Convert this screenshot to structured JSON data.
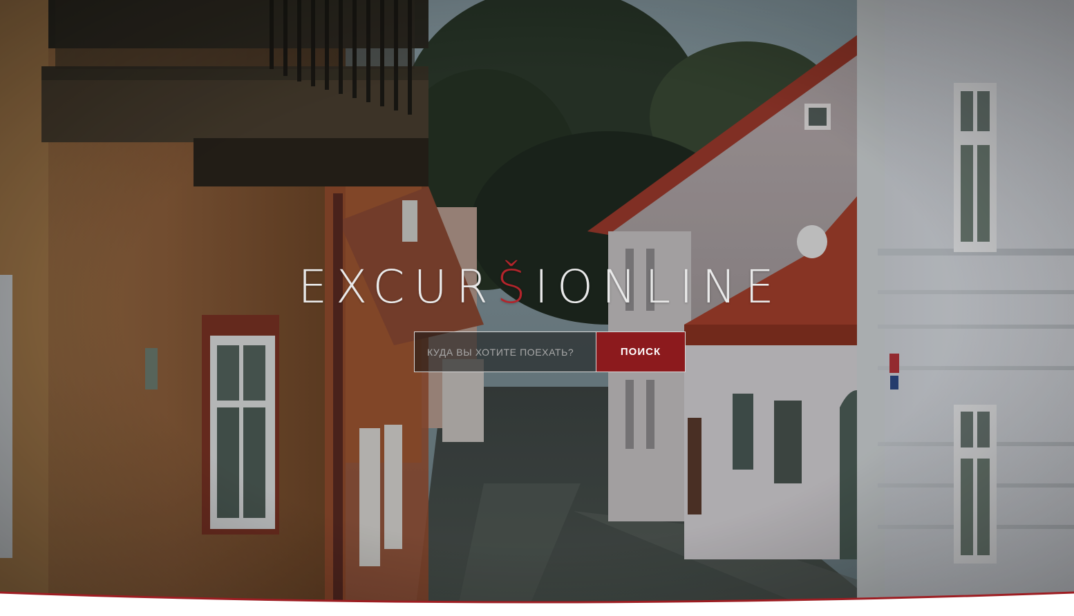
{
  "brand": {
    "logo_before": "EXCUR",
    "logo_accent": "Š",
    "logo_after": "IONLINE",
    "accent_color": "#b3242b"
  },
  "search": {
    "placeholder": "КУДА ВЫ ХОТИТЕ ПОЕХАТЬ?",
    "value": "",
    "button_label": "ПОИСК",
    "button_color": "#8c1a1d"
  },
  "hero": {
    "background_icon": "street-photo-icon",
    "divider_color": "#9d1d22"
  }
}
